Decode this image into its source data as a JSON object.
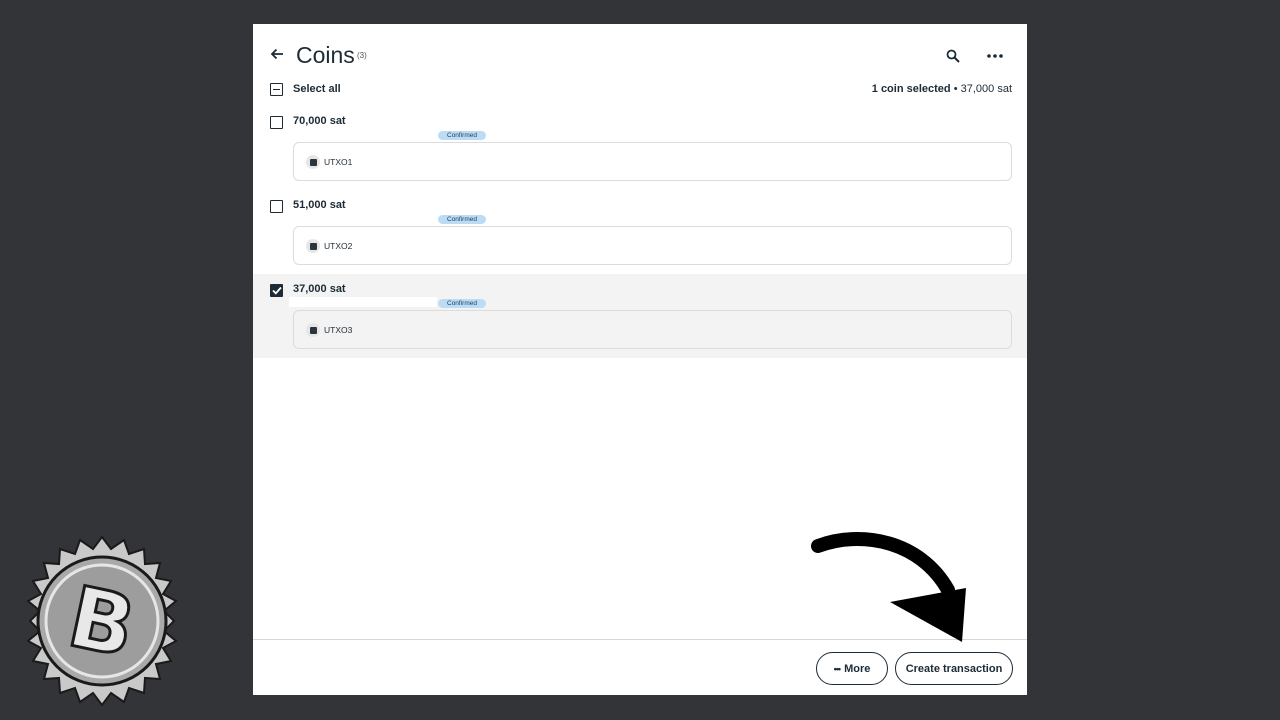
{
  "header": {
    "title": "Coins",
    "count": "(3)",
    "back_icon": "arrow-left-icon",
    "search_icon": "search-icon",
    "more_icon": "ellipsis-icon"
  },
  "select_all": {
    "label": "Select all",
    "state": "partial",
    "selected_count": "1 coin selected",
    "separator": "•",
    "selected_amount": "37,000 sat"
  },
  "coins": [
    {
      "amount": "70,000  sat",
      "status": "Confirmed",
      "label": "UTXO1",
      "checked": false
    },
    {
      "amount": "51,000  sat",
      "status": "Confirmed",
      "label": "UTXO2",
      "checked": false
    },
    {
      "amount": "37,000  sat",
      "status": "Confirmed",
      "label": "UTXO3",
      "checked": true
    }
  ],
  "footer": {
    "more_label": "More",
    "more_icon": "dots-icon",
    "create_label": "Create transaction"
  },
  "colors": {
    "background": "#333437",
    "panel": "#ffffff",
    "text": "#1d2b36",
    "badge": "#bcdcf5",
    "selected_row": "#f3f3f3"
  }
}
